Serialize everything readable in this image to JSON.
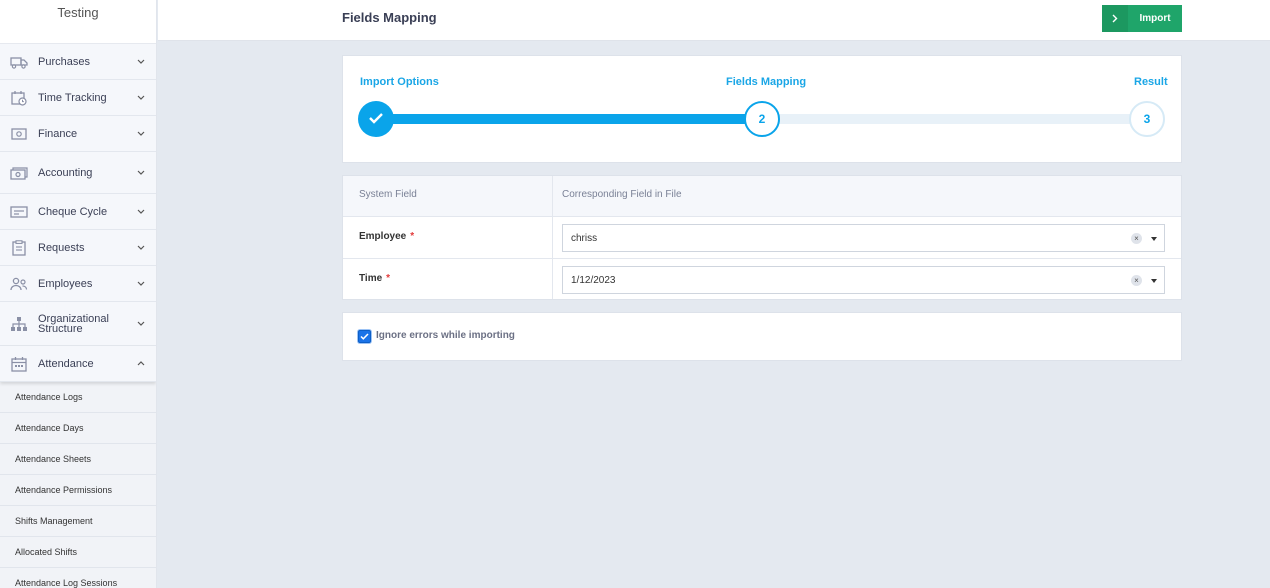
{
  "sidebar": {
    "brand": "Testing",
    "items": [
      {
        "label": "Purchases",
        "icon": "truck-icon"
      },
      {
        "label": "Time Tracking",
        "icon": "calendar-clock-icon"
      },
      {
        "label": "Finance",
        "icon": "cash-icon"
      },
      {
        "label": "Accounting",
        "icon": "money-stack-icon"
      },
      {
        "label": "Cheque Cycle",
        "icon": "cheque-icon"
      },
      {
        "label": "Requests",
        "icon": "clipboard-icon"
      },
      {
        "label": "Employees",
        "icon": "users-icon"
      },
      {
        "label": "Organizational Structure",
        "line1": "Organizational",
        "line2": "Structure",
        "icon": "org-chart-icon"
      },
      {
        "label": "Attendance",
        "icon": "calendar-icon"
      }
    ],
    "sub_items": [
      "Attendance Logs",
      "Attendance Days",
      "Attendance Sheets",
      "Attendance Permissions",
      "Shifts Management",
      "Allocated Shifts",
      "Attendance Log Sessions"
    ]
  },
  "header": {
    "title": "Fields Mapping",
    "import_label": "Import"
  },
  "stepper": {
    "steps": [
      {
        "label": "Import Options",
        "state": "done"
      },
      {
        "label": "Fields Mapping",
        "number": "2",
        "state": "active"
      },
      {
        "label": "Result",
        "number": "3",
        "state": "pending"
      }
    ]
  },
  "mapping": {
    "headers": {
      "system_field": "System Field",
      "corresponding_field": "Corresponding Field in File"
    },
    "rows": [
      {
        "field": "Employee",
        "required": "*",
        "value": "chriss"
      },
      {
        "field": "Time",
        "required": "*",
        "value": "1/12/2023"
      }
    ]
  },
  "options": {
    "ignore_errors_label": "Ignore errors while importing",
    "ignore_errors_checked": true
  },
  "colors": {
    "accent": "#0aa4ea",
    "button": "#1fa56a",
    "required": "#e23b3b"
  }
}
